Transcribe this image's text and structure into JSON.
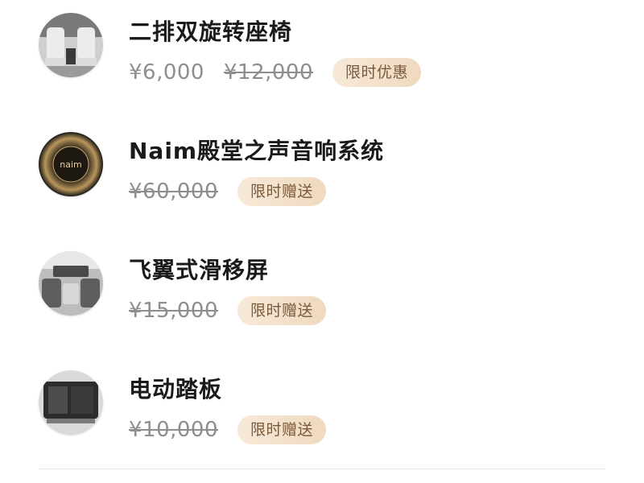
{
  "items": [
    {
      "title": "二排双旋转座椅",
      "price": "¥6,000",
      "original_price": "¥12,000",
      "badge": "限时优惠",
      "image_icon": "swivel-seat-photo"
    },
    {
      "title": "Naim殿堂之声音响系统",
      "original_price": "¥60,000",
      "badge": "限时赠送",
      "image_icon": "naim-speaker-photo",
      "logo_text": "naim"
    },
    {
      "title": "飞翼式滑移屏",
      "original_price": "¥15,000",
      "badge": "限时赠送",
      "image_icon": "sliding-screen-photo"
    },
    {
      "title": "电动踏板",
      "original_price": "¥10,000",
      "badge": "限时赠送",
      "image_icon": "power-step-photo"
    }
  ],
  "colors": {
    "badge_bg": "#f2e0ca",
    "badge_text": "#7a5a3c",
    "price_text": "#8e8e8e",
    "title_text": "#1a1a1a"
  }
}
